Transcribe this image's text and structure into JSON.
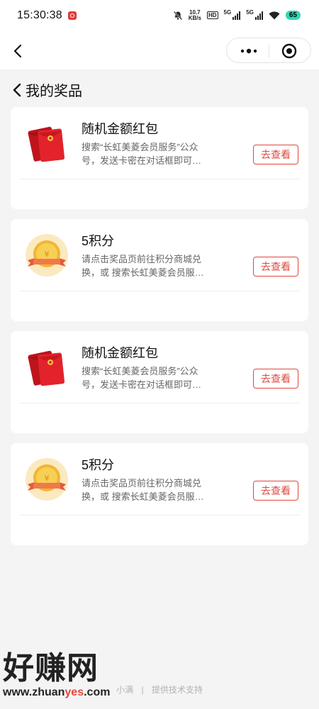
{
  "status_bar": {
    "time": "15:30:38",
    "speed_value": "10.7",
    "speed_unit": "KB/s",
    "hd_label": "HD",
    "net_label_1": "5G",
    "net_label_2": "5G",
    "battery": "65"
  },
  "nav": {
    "more_icon": "more-dots-icon",
    "close_icon": "target-close-icon"
  },
  "page": {
    "title": "我的奖品"
  },
  "prizes": [
    {
      "title": "随机金额红包",
      "desc": "搜索“长虹美菱会员服务”公众号，发送卡密在对话框即可…",
      "button": "去查看",
      "icon": "red-envelope-icon"
    },
    {
      "title": "5积分",
      "desc": "请点击奖品页前往积分商城兑换，或 搜索长虹美菱会员服…",
      "button": "去查看",
      "icon": "gold-coin-icon"
    },
    {
      "title": "随机金额红包",
      "desc": "搜索“长虹美菱会员服务”公众号，发送卡密在对话框即可…",
      "button": "去查看",
      "icon": "red-envelope-icon"
    },
    {
      "title": "5积分",
      "desc": "请点击奖品页前往积分商城兑换，或 搜索长虹美菱会员服…",
      "button": "去查看",
      "icon": "gold-coin-icon"
    }
  ],
  "footer": {
    "provider": "小满",
    "support": "提供技术支持"
  },
  "watermark": {
    "main": "好赚网",
    "url_prefix": "www.zhuan",
    "url_highlight": "yes",
    "url_suffix": ".com"
  },
  "colors": {
    "accent": "#e2473d",
    "background": "#f4f4f4"
  }
}
